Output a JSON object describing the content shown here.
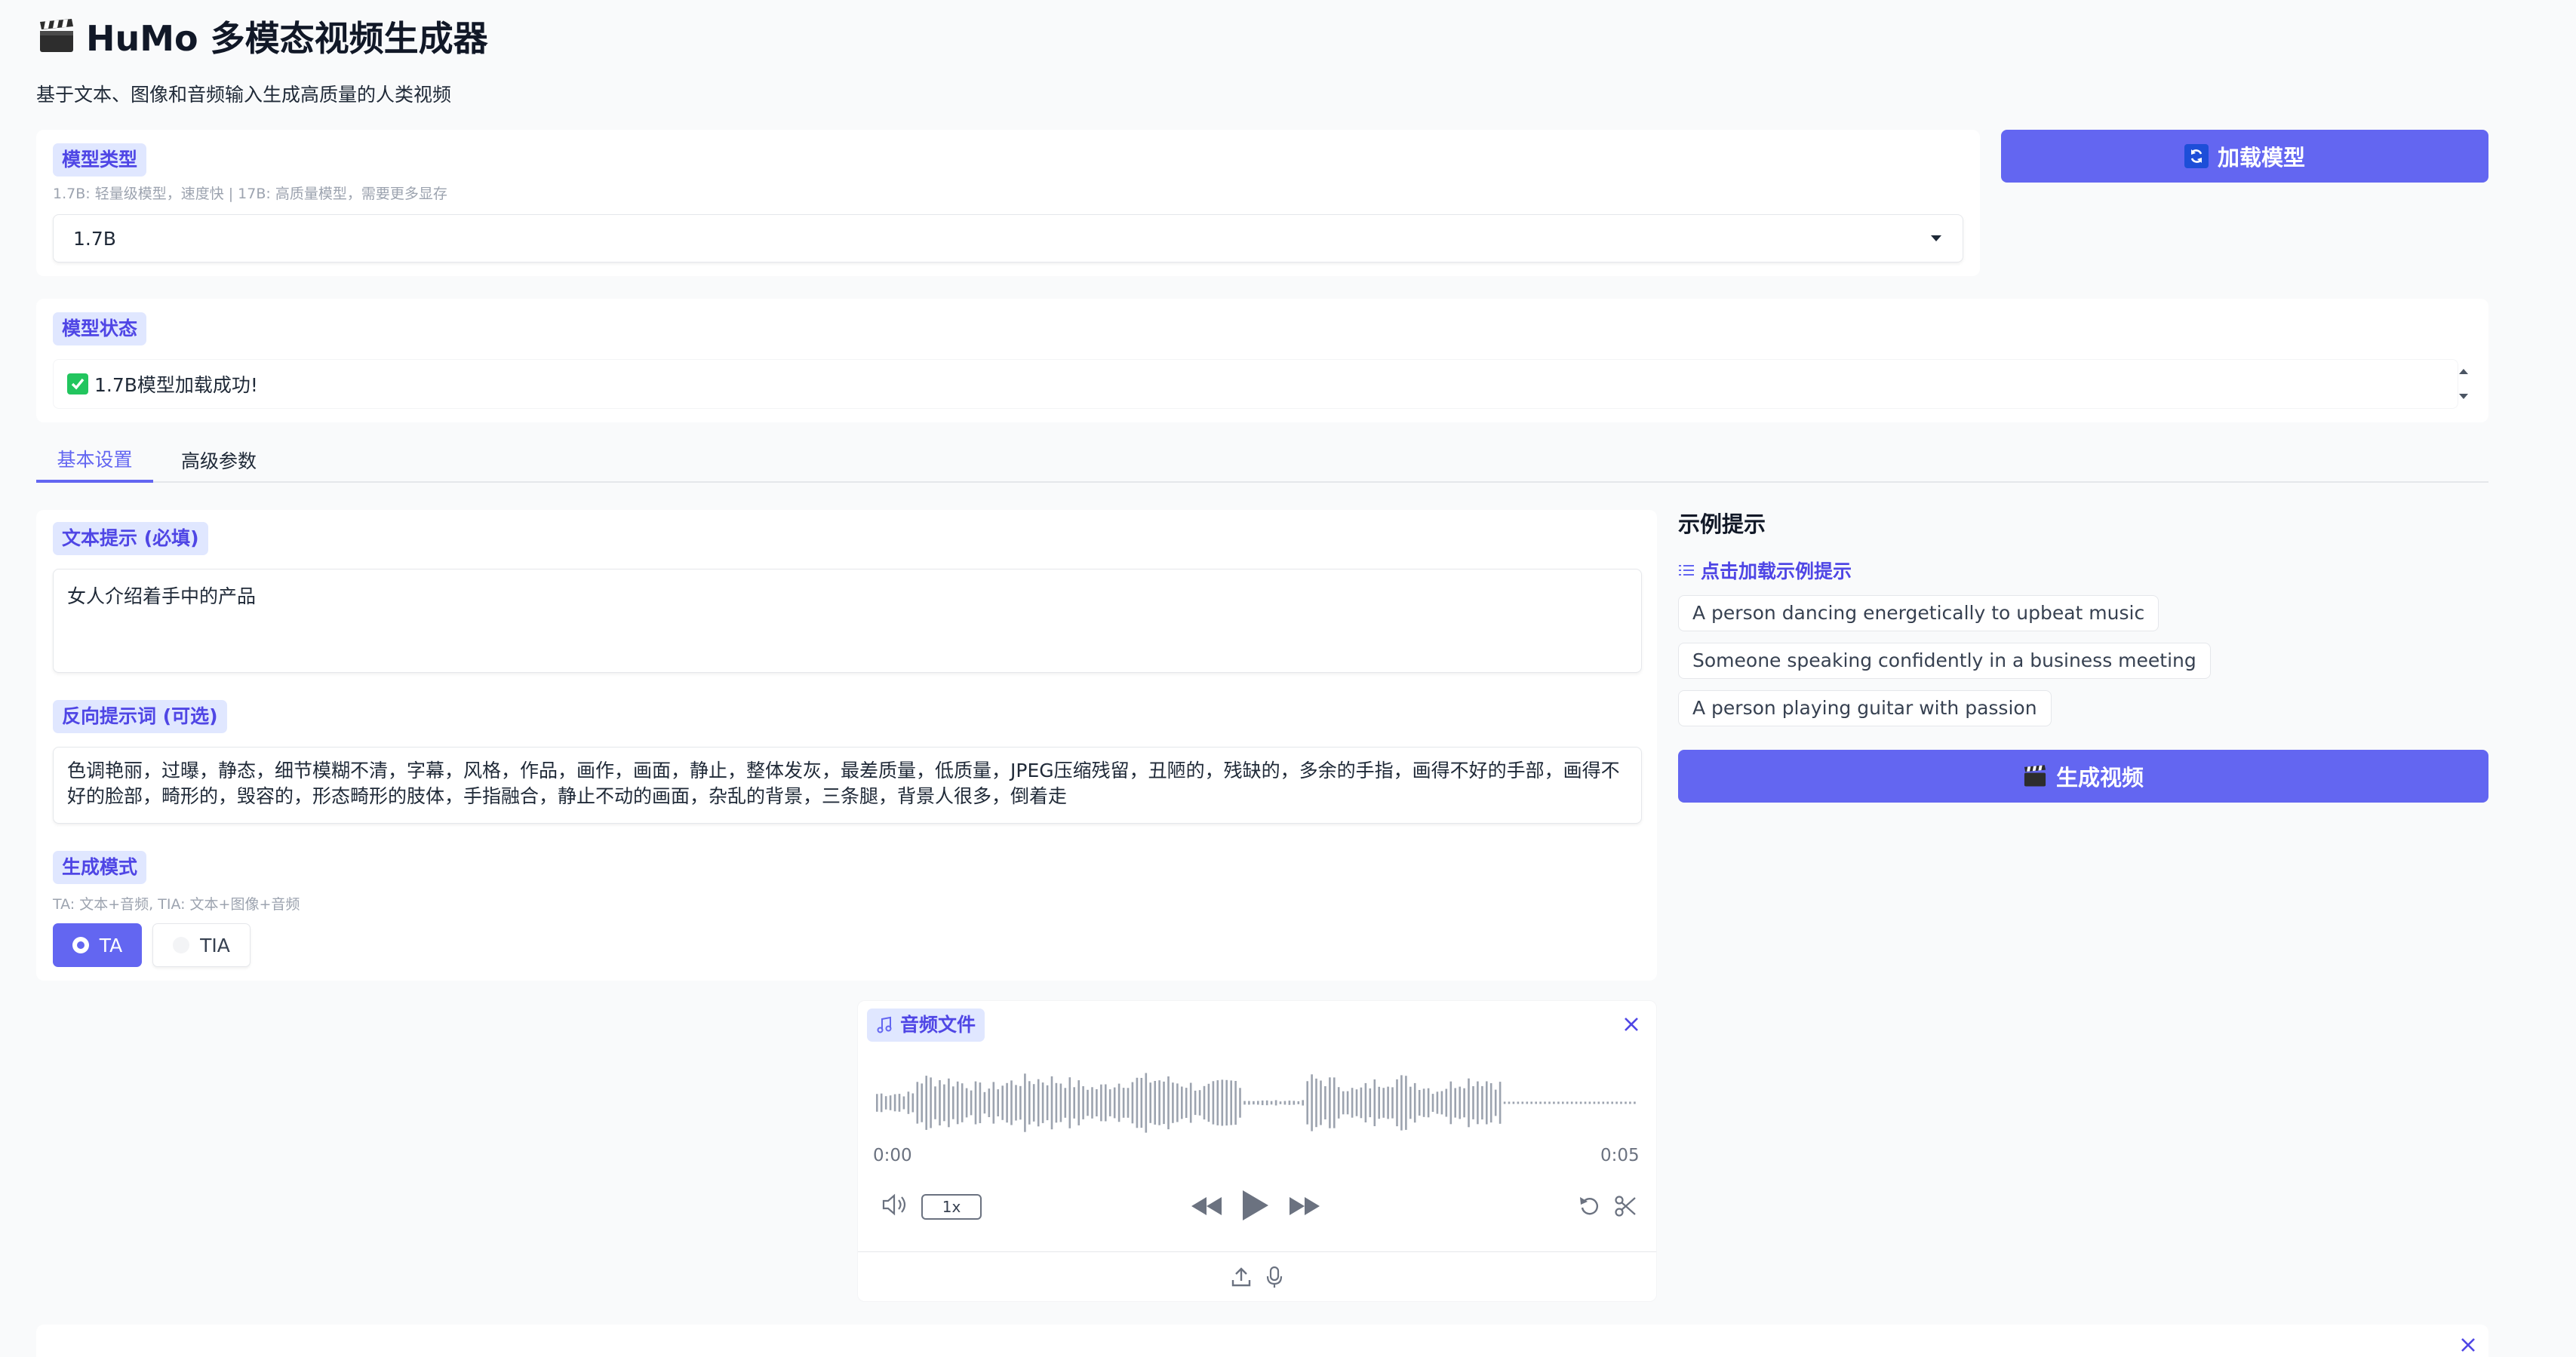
{
  "app": {
    "title": "HuMo 多模态视频生成器",
    "subtitle": "基于文本、图像和音频输入生成高质量的人类视频",
    "title_icon": "clapperboard-icon"
  },
  "model_type": {
    "label": "模型类型",
    "hint": "1.7B: 轻量级模型，速度快 | 17B: 高质量模型，需要更多显存",
    "selected": "1.7B"
  },
  "load_button": {
    "label": "加载模型",
    "icon": "refresh-icon"
  },
  "model_status": {
    "label": "模型状态",
    "value": "1.7B模型加载成功!",
    "icon": "check-mark-icon"
  },
  "tabs": [
    {
      "label": "基本设置",
      "active": true
    },
    {
      "label": "高级参数",
      "active": false
    }
  ],
  "text_prompt": {
    "label": "文本提示 (必填)",
    "value": "女人介绍着手中的产品"
  },
  "negative_prompt": {
    "label": "反向提示词 (可选)",
    "value": "色调艳丽，过曝，静态，细节模糊不清，字幕，风格，作品，画作，画面，静止，整体发灰，最差质量，低质量，JPEG压缩残留，丑陋的，残缺的，多余的手指，画得不好的手部，画得不好的脸部，畸形的，毁容的，形态畸形的肢体，手指融合，静止不动的画面，杂乱的背景，三条腿，背景人很多，倒着走"
  },
  "generation_mode": {
    "label": "生成模式",
    "hint": "TA: 文本+音频, TIA: 文本+图像+音频",
    "options": [
      {
        "label": "TA",
        "selected": true
      },
      {
        "label": "TIA",
        "selected": false
      }
    ]
  },
  "examples": {
    "title": "示例提示",
    "dataset_label": "点击加载示例提示",
    "items": [
      "A person dancing energetically to upbeat music",
      "Someone speaking confidently in a business meeting",
      "A person playing guitar with passion"
    ]
  },
  "generate_button": {
    "label": "生成视频",
    "icon": "clapperboard-icon"
  },
  "audio": {
    "label": "音频文件",
    "time_start": "0:00",
    "time_end": "0:05",
    "speed": "1x",
    "progress": 0
  },
  "colors": {
    "accent": "#6366f1",
    "chip_bg": "#e0e7ff",
    "chip_text": "#4f46e5"
  }
}
